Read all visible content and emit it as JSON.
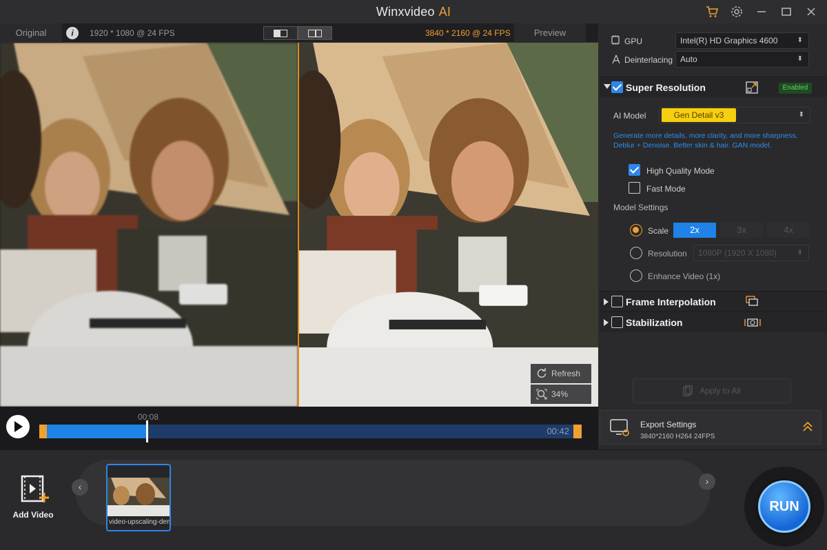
{
  "window": {
    "title": "Winxvideo",
    "title_ai": "AI",
    "icons": [
      "cart-icon",
      "settings-icon",
      "minimize-icon",
      "maximize-icon",
      "close-icon"
    ]
  },
  "preview": {
    "original_tab": "Original",
    "original_meta": "1920 * 1080 @ 24 FPS",
    "preview_meta": "3840 * 2160 @ 24 FPS",
    "preview_tab": "Preview",
    "refresh_label": "Refresh",
    "zoom_label": "34%"
  },
  "timeline": {
    "current_time": "00:08",
    "end_time": "00:42",
    "progress": 0.19
  },
  "panel": {
    "gpu_label": "GPU",
    "gpu_value": "Intel(R) HD Graphics 4600",
    "deinterlacing_label": "Deinterlacing",
    "deinterlacing_value": "Auto",
    "super_resolution": {
      "title": "Super Resolution",
      "checked": true,
      "badge": "Enabled",
      "ai_model_label": "AI Model",
      "ai_model_value": "Gen Detail v3",
      "description": "Generate more details, more clarity, and more sharpness. Deblur + Denoise. Better skin & hair. GAN model.",
      "high_quality_label": "High Quality Mode",
      "fast_mode_label": "Fast Mode",
      "model_settings_label": "Model Settings",
      "scale_label": "Scale",
      "scale_options": [
        "2x",
        "3x",
        "4x"
      ],
      "resolution_label": "Resolution",
      "resolution_value": "1080P (1920 X 1080)",
      "enhance_label": "Enhance Video (1x)"
    },
    "frame_interpolation": {
      "title": "Frame Interpolation"
    },
    "stabilization": {
      "title": "Stabilization"
    },
    "apply_label": "Apply to All"
  },
  "export": {
    "title": "Export Settings",
    "meta": "3840*2160  H264  24FPS"
  },
  "bottom": {
    "add_video_label": "Add Video",
    "thumb_name": "video-upscaling-demo",
    "run_label": "RUN"
  },
  "colors": {
    "accent_orange": "#f0a030",
    "accent_blue": "#2f86ea",
    "badge_green": "#5fd068"
  }
}
